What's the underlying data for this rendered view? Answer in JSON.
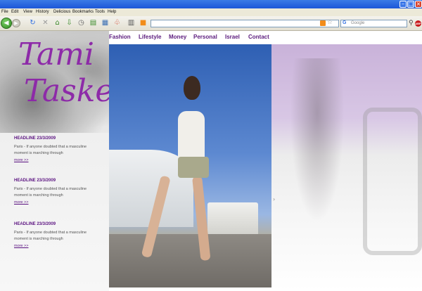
{
  "browser": {
    "menu": [
      "File",
      "Edit",
      "View",
      "History",
      "Delicious",
      "Bookmarks",
      "Tools",
      "Help"
    ],
    "search_placeholder": "Google",
    "search_engine": "G",
    "adblock_label": "ABP"
  },
  "site": {
    "logo_line1": "Tami",
    "logo_line2": "Tasker",
    "nav": [
      "Fashion",
      "Lifestyle",
      "Money",
      "Personal",
      "Israel",
      "Contact"
    ],
    "news": [
      {
        "headline": "HEADLINE 23/3/2009",
        "text": "Paris - If anyone doubted that a masculine moment is marching through",
        "more": "more >>"
      },
      {
        "headline": "HEADLINE 23/3/2009",
        "text": "Paris - If anyone doubted that a masculine moment is marching through",
        "more": "more >>"
      },
      {
        "headline": "HEADLINE 23/3/2009",
        "text": "Paris - If anyone doubted that a masculine moment is marching through",
        "more": "more >>"
      }
    ]
  },
  "colors": {
    "brand": "#8d2aa8",
    "nav": "#5b1b7d"
  }
}
